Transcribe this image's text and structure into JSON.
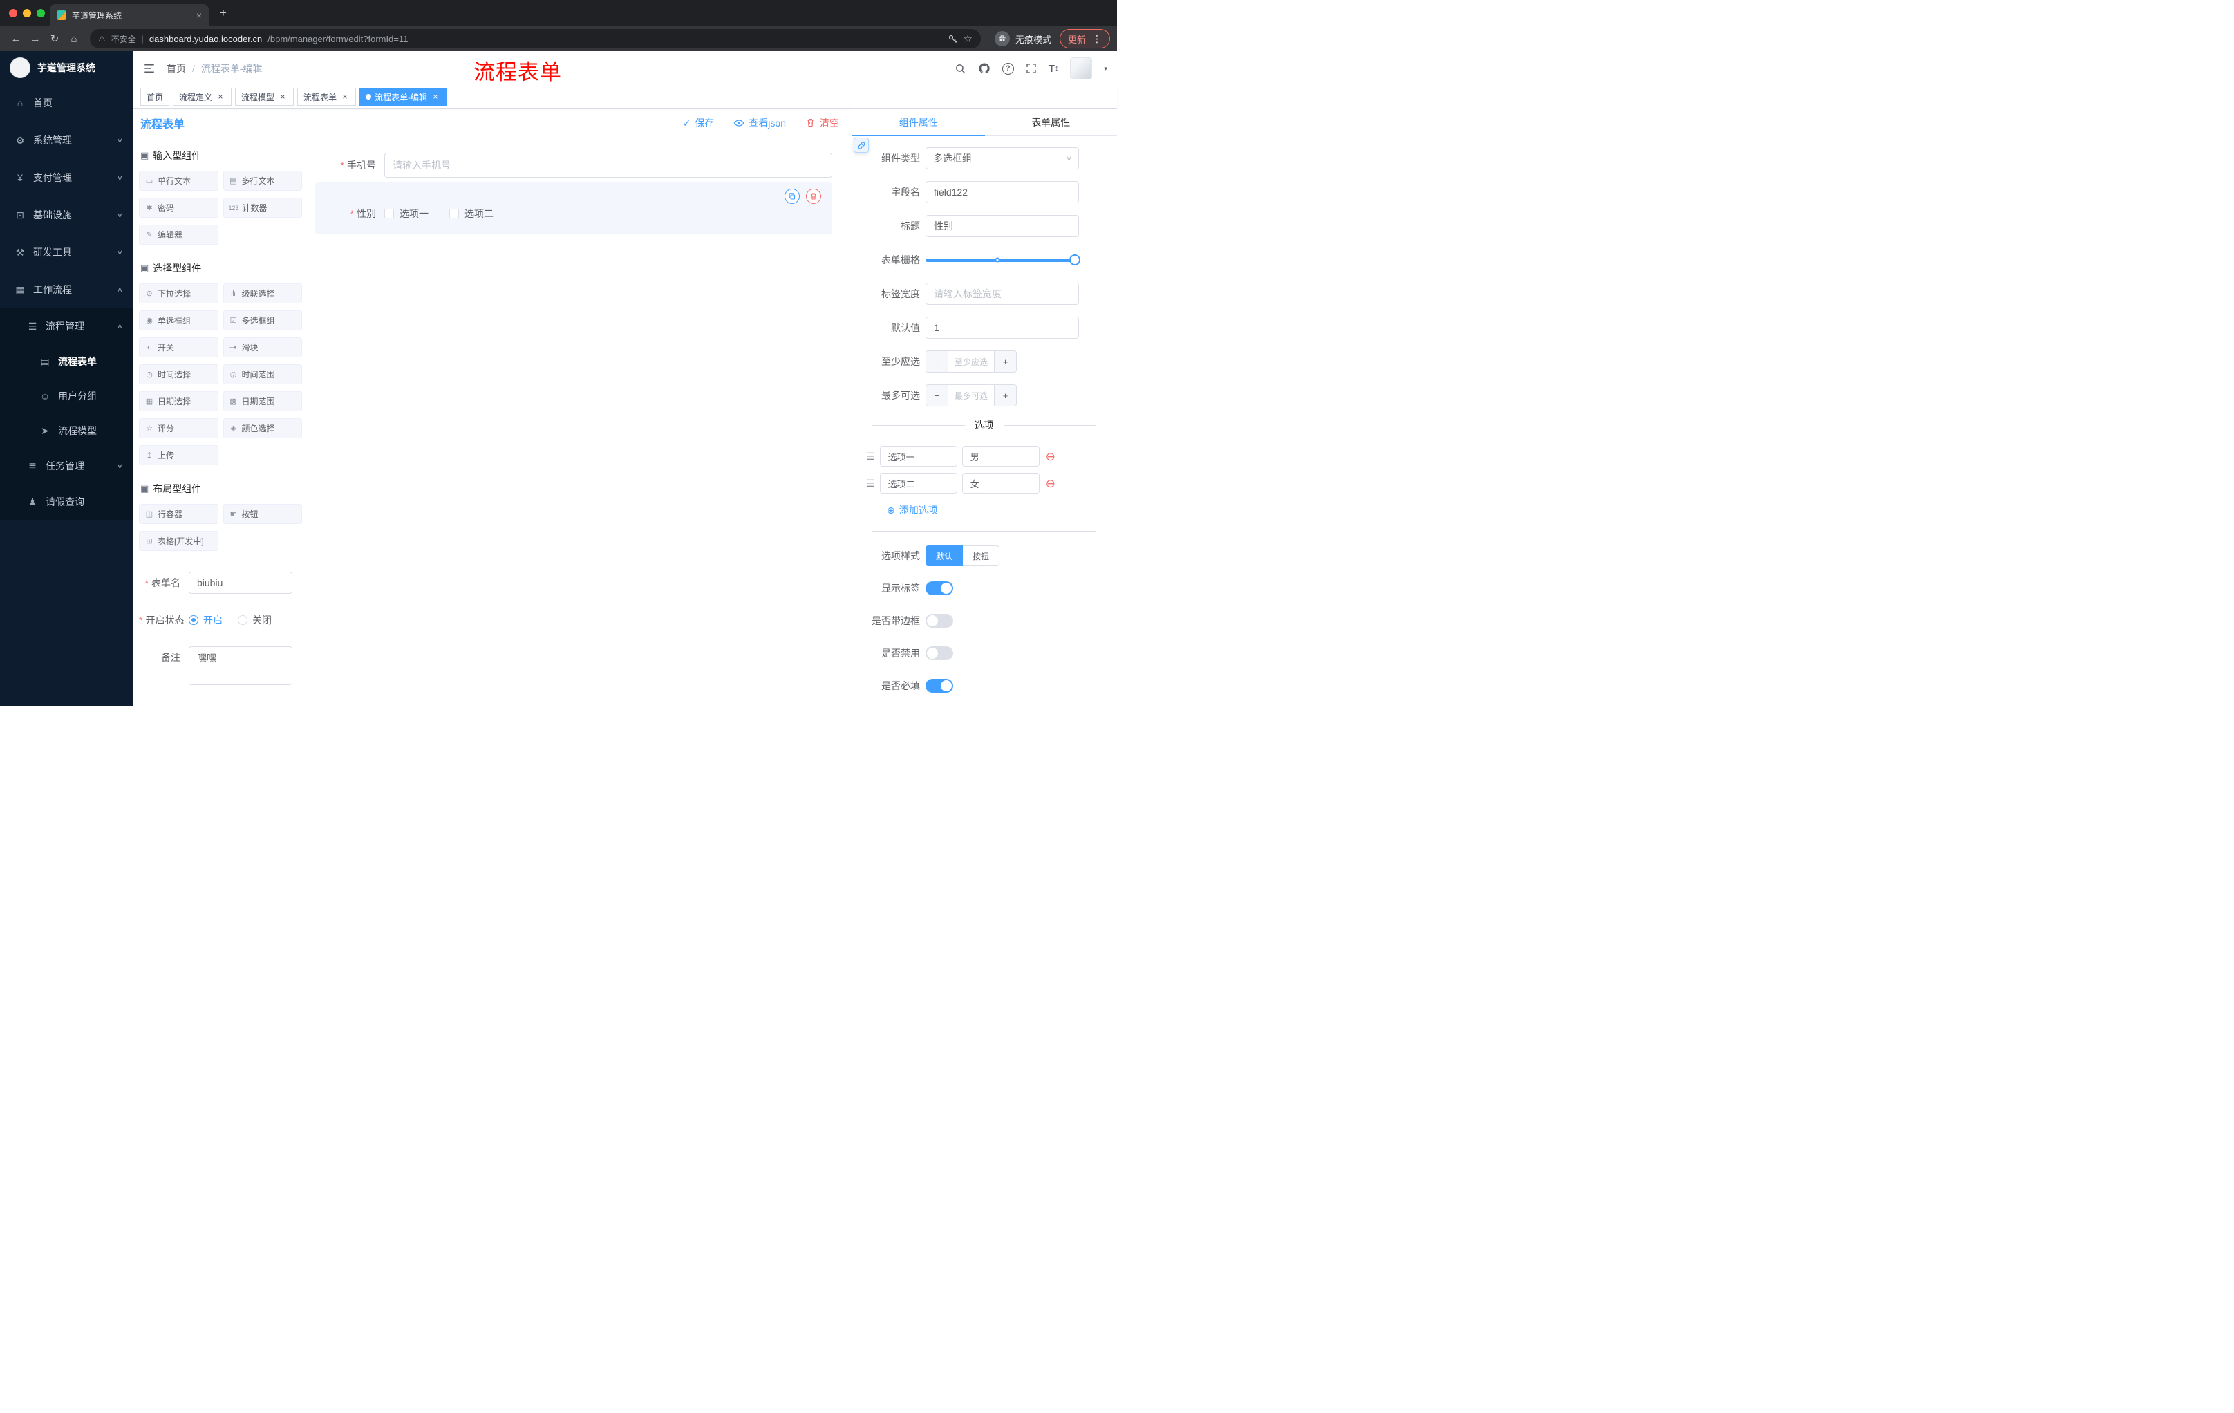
{
  "glyphs": {
    "close": "×",
    "plus": "+",
    "minus": "−",
    "caret_down": "▾",
    "chevron_down": "∨",
    "chevron_up": "∧",
    "dot": "●",
    "check": "✓",
    "warning": "⚠",
    "star": "☆",
    "back": "←",
    "forward": "→",
    "reload": "↻",
    "home": "⌂",
    "menu_dots": "⋮",
    "add_circle": "⊕",
    "remove_circle": "⊖",
    "drag": "☰",
    "group": "▣",
    "question": "?",
    "font_size": "T",
    "updown": "↕",
    "slash": "/",
    "pipe": "|"
  },
  "browser": {
    "tab_title": "芋道管理系统",
    "security_label": "不安全",
    "url_domain": "dashboard.yudao.iocoder.cn",
    "url_path": "/bpm/manager/form/edit?formId=11",
    "incognito_label": "无痕模式",
    "update_label": "更新"
  },
  "sidebar": {
    "logo_title": "芋道管理系统",
    "items": [
      {
        "label": "首页",
        "icon": "⌂"
      },
      {
        "label": "系统管理",
        "icon": "⚙"
      },
      {
        "label": "支付管理",
        "icon": "¥"
      },
      {
        "label": "基础设施",
        "icon": "⊡"
      },
      {
        "label": "研发工具",
        "icon": "⚒"
      },
      {
        "label": "工作流程",
        "icon": "▦"
      },
      {
        "label": "流程管理",
        "icon": "☰"
      },
      {
        "label": "流程表单",
        "icon": "▤"
      },
      {
        "label": "用户分组",
        "icon": "☺"
      },
      {
        "label": "流程模型",
        "icon": "➤"
      },
      {
        "label": "任务管理",
        "icon": "≣"
      },
      {
        "label": "请假查询",
        "icon": "♟"
      }
    ]
  },
  "header": {
    "breadcrumb_home": "首页",
    "breadcrumb_current": "流程表单-编辑",
    "annotation": "流程表单"
  },
  "tags": [
    {
      "label": "首页"
    },
    {
      "label": "流程定义"
    },
    {
      "label": "流程模型"
    },
    {
      "label": "流程表单"
    },
    {
      "label": "流程表单-编辑"
    }
  ],
  "designer": {
    "title": "流程表单",
    "save_label": "保存",
    "view_json_label": "查看json",
    "clear_label": "清空",
    "groups": [
      {
        "title": "输入型组件",
        "items": [
          {
            "icon": "▭",
            "label": "单行文本"
          },
          {
            "icon": "▤",
            "label": "多行文本"
          },
          {
            "icon": "✱",
            "label": "密码"
          },
          {
            "icon": "123",
            "label": "计数器"
          },
          {
            "icon": "✎",
            "label": "编辑器"
          }
        ]
      },
      {
        "title": "选择型组件",
        "items": [
          {
            "icon": "⊙",
            "label": "下拉选择"
          },
          {
            "icon": "⋔",
            "label": "级联选择"
          },
          {
            "icon": "◉",
            "label": "单选框组"
          },
          {
            "icon": "☑",
            "label": "多选框组"
          },
          {
            "icon": "◐",
            "label": "开关"
          },
          {
            "icon": "─●",
            "label": "滑块"
          },
          {
            "icon": "◷",
            "label": "时间选择"
          },
          {
            "icon": "◶",
            "label": "时间范围"
          },
          {
            "icon": "▦",
            "label": "日期选择"
          },
          {
            "icon": "▩",
            "label": "日期范围"
          },
          {
            "icon": "☆",
            "label": "评分"
          },
          {
            "icon": "◈",
            "label": "颜色选择"
          },
          {
            "icon": "↥",
            "label": "上传"
          }
        ]
      },
      {
        "title": "布局型组件",
        "items": [
          {
            "icon": "◫",
            "label": "行容器"
          },
          {
            "icon": "☛",
            "label": "按钮"
          },
          {
            "icon": "⊞",
            "label": "表格[开发中]"
          }
        ]
      }
    ],
    "meta": {
      "name_label": "表单名",
      "name_value": "biubiu",
      "status_label": "开启状态",
      "status_on": "开启",
      "status_off": "关闭",
      "remark_label": "备注",
      "remark_value": "嘿嘿"
    },
    "canvas": {
      "phone_label": "手机号",
      "phone_placeholder": "请输入手机号",
      "gender_label": "性别",
      "option1": "选项一",
      "option2": "选项二"
    }
  },
  "props": {
    "tab_component": "组件属性",
    "tab_form": "表单属性",
    "component_type_label": "组件类型",
    "component_type_value": "多选框组",
    "field_name_label": "字段名",
    "field_name_value": "field122",
    "title_label": "标题",
    "title_value": "性别",
    "grid_label": "表单栅格",
    "tag_width_label": "标签宽度",
    "tag_width_placeholder": "请输入标签宽度",
    "default_label": "默认值",
    "default_value": "1",
    "min_label": "至少应选",
    "min_placeholder": "至少应选",
    "max_label": "最多可选",
    "max_placeholder": "最多可选",
    "options_title": "选项",
    "options": [
      {
        "label": "选项一",
        "value": "男"
      },
      {
        "label": "选项二",
        "value": "女"
      }
    ],
    "add_option_label": "添加选项",
    "style_label": "选项样式",
    "style_default": "默认",
    "style_button": "按钮",
    "toggles": [
      {
        "label": "显示标签",
        "on": true
      },
      {
        "label": "是否带边框",
        "on": false
      },
      {
        "label": "是否禁用",
        "on": false
      },
      {
        "label": "是否必填",
        "on": true
      }
    ]
  }
}
